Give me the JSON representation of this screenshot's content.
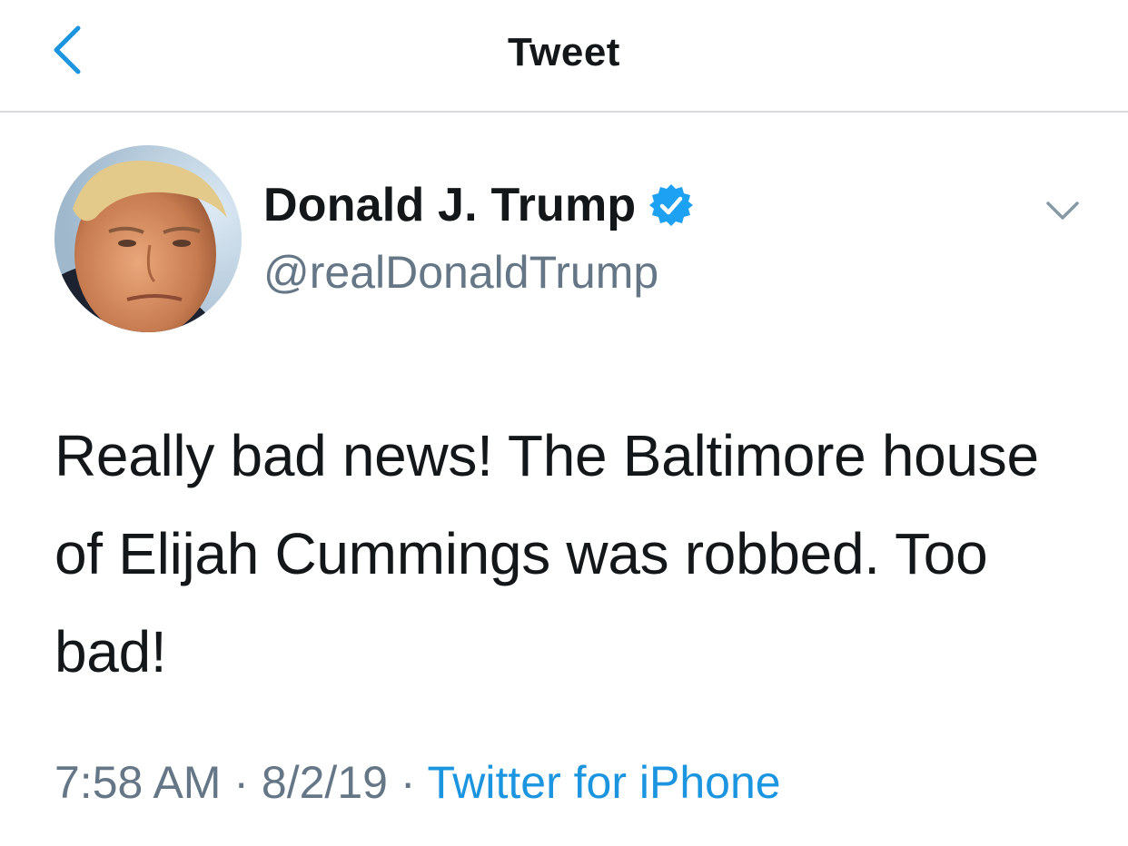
{
  "header": {
    "title": "Tweet",
    "back_icon": "chevron-left-icon"
  },
  "author": {
    "name": "Donald J. Trump",
    "handle": "@realDonaldTrump",
    "verified_icon": "verified-badge-icon",
    "menu_icon": "chevron-down-icon"
  },
  "tweet": {
    "text": "Really bad news! The Baltimore house of Elijah Cummings was robbed. Too bad!",
    "time": "7:58 AM",
    "separator": "·",
    "date": "8/2/19",
    "source": "Twitter for iPhone"
  },
  "colors": {
    "accent": "#1b95e0",
    "secondary_text": "#657786",
    "primary_text": "#14171a",
    "divider": "#d9d9dc"
  }
}
